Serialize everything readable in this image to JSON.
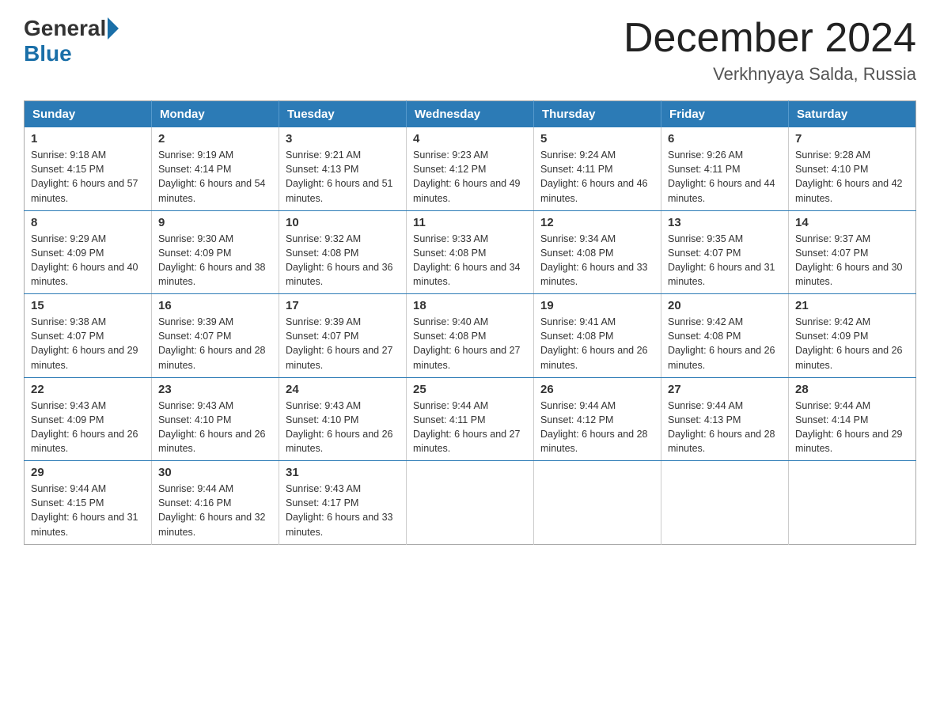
{
  "header": {
    "logo_general": "General",
    "logo_blue": "Blue",
    "month_title": "December 2024",
    "location": "Verkhnyaya Salda, Russia"
  },
  "weekdays": [
    "Sunday",
    "Monday",
    "Tuesday",
    "Wednesday",
    "Thursday",
    "Friday",
    "Saturday"
  ],
  "weeks": [
    [
      {
        "day": "1",
        "sunrise": "9:18 AM",
        "sunset": "4:15 PM",
        "daylight": "6 hours and 57 minutes."
      },
      {
        "day": "2",
        "sunrise": "9:19 AM",
        "sunset": "4:14 PM",
        "daylight": "6 hours and 54 minutes."
      },
      {
        "day": "3",
        "sunrise": "9:21 AM",
        "sunset": "4:13 PM",
        "daylight": "6 hours and 51 minutes."
      },
      {
        "day": "4",
        "sunrise": "9:23 AM",
        "sunset": "4:12 PM",
        "daylight": "6 hours and 49 minutes."
      },
      {
        "day": "5",
        "sunrise": "9:24 AM",
        "sunset": "4:11 PM",
        "daylight": "6 hours and 46 minutes."
      },
      {
        "day": "6",
        "sunrise": "9:26 AM",
        "sunset": "4:11 PM",
        "daylight": "6 hours and 44 minutes."
      },
      {
        "day": "7",
        "sunrise": "9:28 AM",
        "sunset": "4:10 PM",
        "daylight": "6 hours and 42 minutes."
      }
    ],
    [
      {
        "day": "8",
        "sunrise": "9:29 AM",
        "sunset": "4:09 PM",
        "daylight": "6 hours and 40 minutes."
      },
      {
        "day": "9",
        "sunrise": "9:30 AM",
        "sunset": "4:09 PM",
        "daylight": "6 hours and 38 minutes."
      },
      {
        "day": "10",
        "sunrise": "9:32 AM",
        "sunset": "4:08 PM",
        "daylight": "6 hours and 36 minutes."
      },
      {
        "day": "11",
        "sunrise": "9:33 AM",
        "sunset": "4:08 PM",
        "daylight": "6 hours and 34 minutes."
      },
      {
        "day": "12",
        "sunrise": "9:34 AM",
        "sunset": "4:08 PM",
        "daylight": "6 hours and 33 minutes."
      },
      {
        "day": "13",
        "sunrise": "9:35 AM",
        "sunset": "4:07 PM",
        "daylight": "6 hours and 31 minutes."
      },
      {
        "day": "14",
        "sunrise": "9:37 AM",
        "sunset": "4:07 PM",
        "daylight": "6 hours and 30 minutes."
      }
    ],
    [
      {
        "day": "15",
        "sunrise": "9:38 AM",
        "sunset": "4:07 PM",
        "daylight": "6 hours and 29 minutes."
      },
      {
        "day": "16",
        "sunrise": "9:39 AM",
        "sunset": "4:07 PM",
        "daylight": "6 hours and 28 minutes."
      },
      {
        "day": "17",
        "sunrise": "9:39 AM",
        "sunset": "4:07 PM",
        "daylight": "6 hours and 27 minutes."
      },
      {
        "day": "18",
        "sunrise": "9:40 AM",
        "sunset": "4:08 PM",
        "daylight": "6 hours and 27 minutes."
      },
      {
        "day": "19",
        "sunrise": "9:41 AM",
        "sunset": "4:08 PM",
        "daylight": "6 hours and 26 minutes."
      },
      {
        "day": "20",
        "sunrise": "9:42 AM",
        "sunset": "4:08 PM",
        "daylight": "6 hours and 26 minutes."
      },
      {
        "day": "21",
        "sunrise": "9:42 AM",
        "sunset": "4:09 PM",
        "daylight": "6 hours and 26 minutes."
      }
    ],
    [
      {
        "day": "22",
        "sunrise": "9:43 AM",
        "sunset": "4:09 PM",
        "daylight": "6 hours and 26 minutes."
      },
      {
        "day": "23",
        "sunrise": "9:43 AM",
        "sunset": "4:10 PM",
        "daylight": "6 hours and 26 minutes."
      },
      {
        "day": "24",
        "sunrise": "9:43 AM",
        "sunset": "4:10 PM",
        "daylight": "6 hours and 26 minutes."
      },
      {
        "day": "25",
        "sunrise": "9:44 AM",
        "sunset": "4:11 PM",
        "daylight": "6 hours and 27 minutes."
      },
      {
        "day": "26",
        "sunrise": "9:44 AM",
        "sunset": "4:12 PM",
        "daylight": "6 hours and 28 minutes."
      },
      {
        "day": "27",
        "sunrise": "9:44 AM",
        "sunset": "4:13 PM",
        "daylight": "6 hours and 28 minutes."
      },
      {
        "day": "28",
        "sunrise": "9:44 AM",
        "sunset": "4:14 PM",
        "daylight": "6 hours and 29 minutes."
      }
    ],
    [
      {
        "day": "29",
        "sunrise": "9:44 AM",
        "sunset": "4:15 PM",
        "daylight": "6 hours and 31 minutes."
      },
      {
        "day": "30",
        "sunrise": "9:44 AM",
        "sunset": "4:16 PM",
        "daylight": "6 hours and 32 minutes."
      },
      {
        "day": "31",
        "sunrise": "9:43 AM",
        "sunset": "4:17 PM",
        "daylight": "6 hours and 33 minutes."
      },
      null,
      null,
      null,
      null
    ]
  ]
}
